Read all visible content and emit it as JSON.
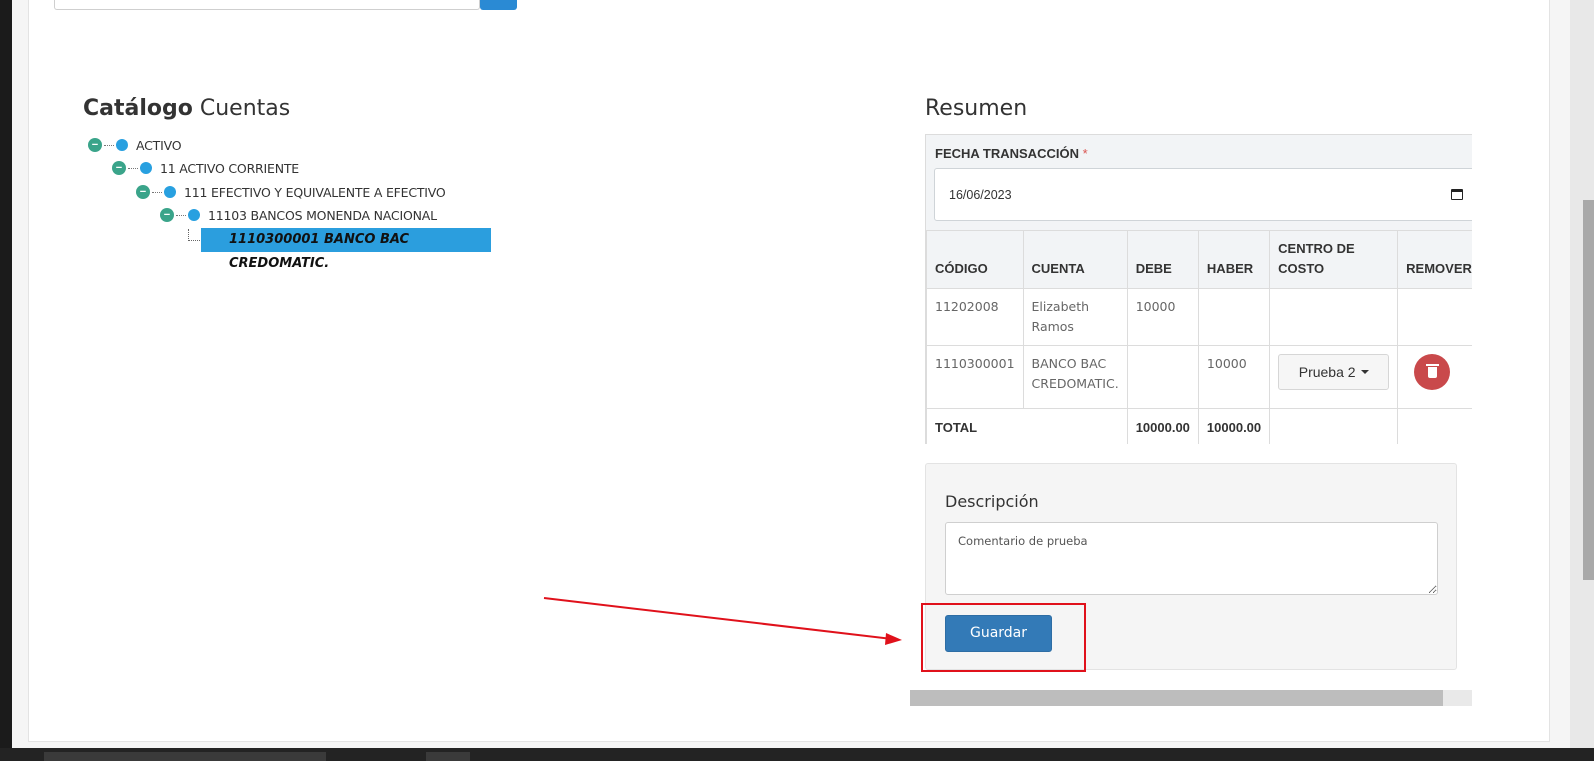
{
  "tree": {
    "title_bold": "Catálogo",
    "title_regular": "Cuentas",
    "nodes": [
      {
        "toggle": "−",
        "label": "ACTIVO"
      },
      {
        "toggle": "−",
        "label": "11 ACTIVO CORRIENTE"
      },
      {
        "toggle": "−",
        "label": "111 EFECTIVO Y EQUIVALENTE A EFECTIVO"
      },
      {
        "toggle": "−",
        "label": "11103 BANCOS MONENDA NACIONAL"
      }
    ],
    "selected_leaf": "1110300001 BANCO BAC CREDOMATIC."
  },
  "summary": {
    "title": "Resumen",
    "date_label": "FECHA TRANSACCIÓN",
    "required_mark": "*",
    "date_value": "16/06/2023",
    "columns": [
      "CÓDIGO",
      "CUENTA",
      "DEBE",
      "HABER",
      "CENTRO DE COSTO",
      "REMOVER"
    ],
    "rows": [
      {
        "codigo": "11202008",
        "cuenta": "Elizabeth Ramos",
        "debe": "10000",
        "haber": "",
        "centro": "",
        "remover": false
      },
      {
        "codigo": "1110300001",
        "cuenta": "BANCO BAC CREDOMATIC.",
        "debe": "",
        "haber": "10000",
        "centro": "Prueba 2",
        "remover": true
      }
    ],
    "total": {
      "label": "TOTAL",
      "debe": "10000.00",
      "haber": "10000.00"
    }
  },
  "description": {
    "label": "Descripción",
    "value": "Comentario de prueba",
    "save_label": "Guardar"
  },
  "colors": {
    "primary": "#337ab7",
    "danger": "#c9494b",
    "tree_selected": "#2b9ede",
    "annotation": "#e0111b"
  }
}
